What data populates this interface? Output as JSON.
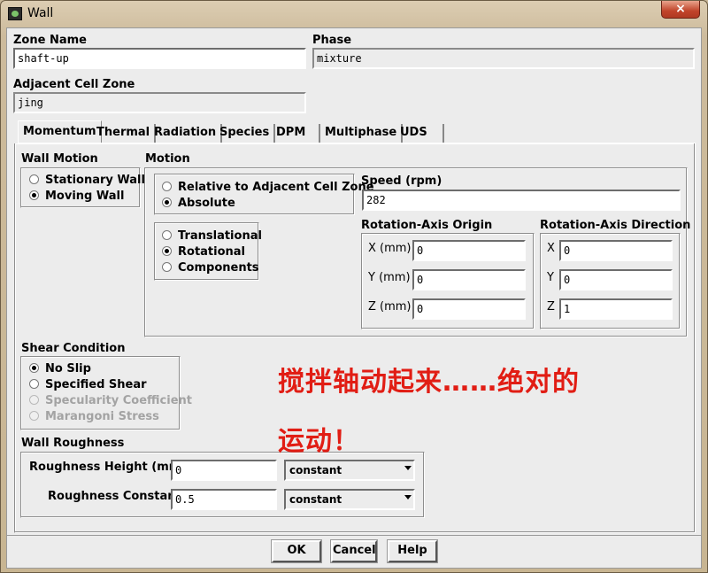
{
  "window": {
    "title": "Wall",
    "close_label": "×"
  },
  "zone_name": {
    "label": "Zone Name",
    "value": "shaft-up"
  },
  "phase": {
    "label": "Phase",
    "value": "mixture"
  },
  "adjacent_cell_zone": {
    "label": "Adjacent Cell Zone",
    "value": "jing"
  },
  "tabs": [
    {
      "label": "Momentum",
      "active": true
    },
    {
      "label": "Thermal"
    },
    {
      "label": "Radiation"
    },
    {
      "label": "Species"
    },
    {
      "label": "DPM"
    },
    {
      "label": "Multiphase"
    },
    {
      "label": "UDS"
    }
  ],
  "wall_motion": {
    "label": "Wall Motion",
    "options": [
      "Stationary Wall",
      "Moving Wall"
    ],
    "selected": "Moving Wall"
  },
  "motion": {
    "label": "Motion",
    "reference_options": [
      "Relative to Adjacent Cell Zone",
      "Absolute"
    ],
    "reference_selected": "Absolute",
    "type_options": [
      "Translational",
      "Rotational",
      "Components"
    ],
    "type_selected": "Rotational",
    "speed": {
      "label": "Speed (rpm)",
      "value": "282"
    },
    "axis_origin": {
      "label": "Rotation-Axis Origin",
      "x_label": "X (mm)",
      "x": "0",
      "y_label": "Y (mm)",
      "y": "0",
      "z_label": "Z (mm)",
      "z": "0"
    },
    "axis_direction": {
      "label": "Rotation-Axis Direction",
      "x_label": "X",
      "x": "0",
      "y_label": "Y",
      "y": "0",
      "z_label": "Z",
      "z": "1"
    }
  },
  "shear_condition": {
    "label": "Shear Condition",
    "options": [
      "No Slip",
      "Specified Shear",
      "Specularity Coefficient",
      "Marangoni Stress"
    ],
    "selected": "No Slip"
  },
  "wall_roughness": {
    "label": "Wall Roughness",
    "height_label": "Roughness Height (mm)",
    "height_value": "0",
    "height_method": "constant",
    "constant_label": "Roughness Constant",
    "constant_value": "0.5",
    "constant_method": "constant"
  },
  "annotation": {
    "line1": "搅拌轴动起来……绝对的",
    "line2": "运动！",
    "color": "#e11d14"
  },
  "buttons": {
    "ok": "OK",
    "cancel": "Cancel",
    "help": "Help"
  }
}
